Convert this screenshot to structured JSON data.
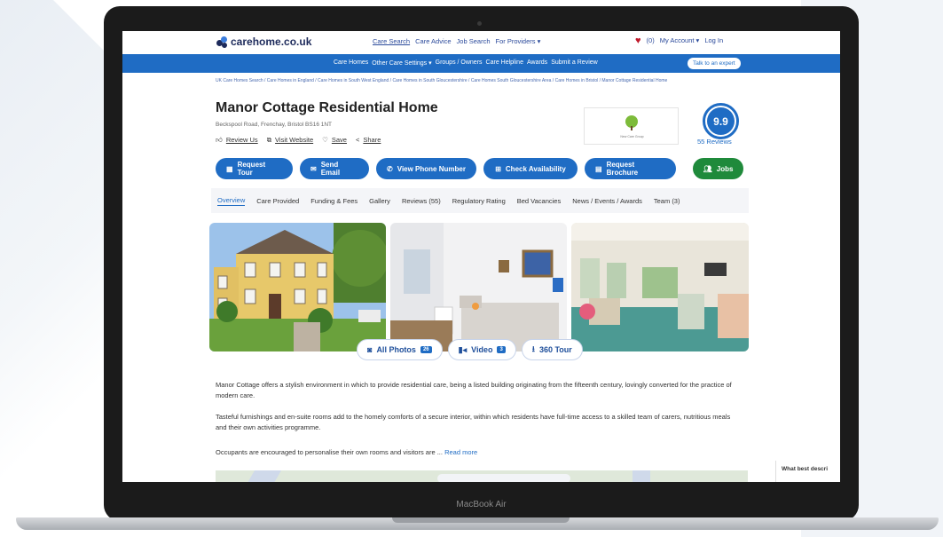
{
  "device": {
    "label": "MacBook Air"
  },
  "site": {
    "logo_text": "carehome.co.uk",
    "top_nav": [
      "Care Search",
      "Care Advice",
      "Job Search",
      "For Providers ▾"
    ],
    "top_right": {
      "count": "(0)",
      "account": "My Account ▾",
      "login": "Log In"
    },
    "blue_nav": [
      "Care Homes",
      "Other Care Settings ▾",
      "Groups / Owners",
      "Care Helpline",
      "Awards",
      "Submit a Review"
    ],
    "talk_button": "Talk to an expert"
  },
  "breadcrumbs": "UK Care Homes Search / Care Homes in England / Care Homes in South West England / Care Homes in South Gloucestershire / Care Homes South Gloucestershire Area / Care Homes in Bristol / Manor Cottage Residential Home",
  "home": {
    "title": "Manor Cottage Residential Home",
    "address": "Beckspool Road, Frenchay, Bristol BS16 1NT",
    "actions": [
      "Review Us",
      "Visit Website",
      "Save",
      "Share"
    ],
    "group_logo_text": "New Care Group",
    "score": "9.9",
    "reviews_count": "55 Reviews"
  },
  "buttons": [
    "Request Tour",
    "Send Email",
    "View Phone Number",
    "Check Availability",
    "Request Brochure",
    "Jobs"
  ],
  "tabs": [
    "Overview",
    "Care Provided",
    "Funding & Fees",
    "Gallery",
    "Reviews (55)",
    "Regulatory Rating",
    "Bed Vacancies",
    "News / Events / Awards",
    "Team (3)"
  ],
  "media": {
    "photos_label": "All Photos",
    "photos_count": "26",
    "video_label": "Video",
    "video_count": "3",
    "tour_label": "360 Tour"
  },
  "description": [
    "Manor Cottage offers a stylish environment in which to provide residential care, being a listed building originating from the fifteenth century, lovingly converted for the practice of modern care.",
    "Tasteful furnishings and en-suite rooms add to the homely comforts of a secure interior, within which residents have full-time access to a skilled team of carers, nutritious meals and their own activities programme.",
    "Occupants are encouraged to personalise their own rooms and visitors are ..."
  ],
  "read_more": "Read more",
  "survey_prompt": "What best descri",
  "colors": {
    "brand_blue": "#1f6cc4",
    "jobs_green": "#1f8a3b",
    "heart_red": "#c0192b"
  }
}
